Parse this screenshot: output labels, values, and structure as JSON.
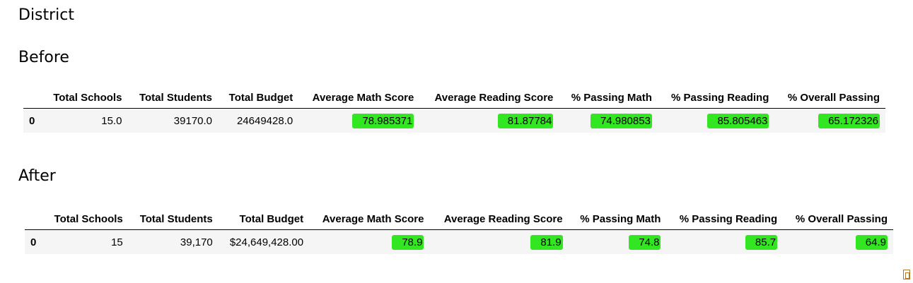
{
  "title": "District",
  "before": {
    "label": "Before",
    "columns": [
      "",
      "Total Schools",
      "Total Students",
      "Total Budget",
      "Average Math Score",
      "Average Reading Score",
      "% Passing Math",
      "% Passing Reading",
      "% Overall Passing"
    ],
    "rows": [
      {
        "index": "0",
        "cells": [
          "15.0",
          "39170.0",
          "24649428.0",
          "78.985371",
          "81.87784",
          "74.980853",
          "85.805463",
          "65.172326"
        ]
      }
    ]
  },
  "after": {
    "label": "After",
    "columns": [
      "",
      "Total Schools",
      "Total Students",
      "Total Budget",
      "Average Math Score",
      "Average Reading Score",
      "% Passing Math",
      "% Passing Reading",
      "% Overall Passing"
    ],
    "rows": [
      {
        "index": "0",
        "cells": [
          "15",
          "39,170",
          "$24,649,428.00",
          "78.9",
          "81.9",
          "74.8",
          "85.7",
          "64.9"
        ]
      }
    ]
  },
  "highlight_color": "#33e622",
  "corner_icon": "paste-options-icon"
}
